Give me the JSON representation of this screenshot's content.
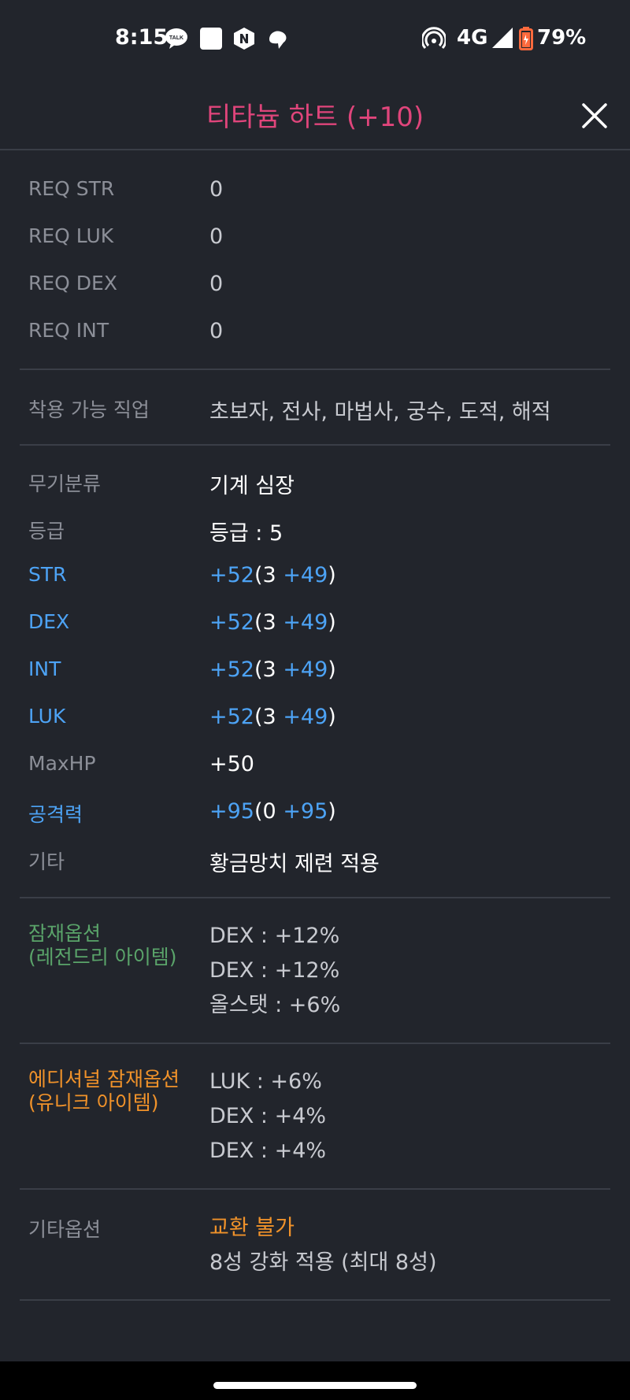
{
  "status_bar": {
    "time": "8:15",
    "network": "4G",
    "battery": "79%",
    "icons": [
      "talk-icon",
      "square-app-icon",
      "naver-icon",
      "cloud-app-icon",
      "hotspot-icon",
      "signal-icon",
      "battery-icon"
    ],
    "talk_icon_text": "TALK"
  },
  "header": {
    "title": "티타늄 하트 (+10)",
    "title_color": "#e0457b"
  },
  "requirements": [
    {
      "label": "REQ STR",
      "value": "0"
    },
    {
      "label": "REQ LUK",
      "value": "0"
    },
    {
      "label": "REQ DEX",
      "value": "0"
    },
    {
      "label": "REQ INT",
      "value": "0"
    }
  ],
  "jobs": {
    "label": "착용 가능 직업",
    "value": "초보자, 전사, 마법사, 궁수, 도적, 해적"
  },
  "info": {
    "category": {
      "label": "무기분류",
      "value": "기계 심장"
    },
    "grade": {
      "label": "등급",
      "value": "등급 : 5"
    },
    "stats": [
      {
        "label": "STR",
        "total": "+52",
        "base": "3",
        "bonus": "+49"
      },
      {
        "label": "DEX",
        "total": "+52",
        "base": "3",
        "bonus": "+49"
      },
      {
        "label": "INT",
        "total": "+52",
        "base": "3",
        "bonus": "+49"
      },
      {
        "label": "LUK",
        "total": "+52",
        "base": "3",
        "bonus": "+49"
      }
    ],
    "maxhp": {
      "label": "MaxHP",
      "value": "+50"
    },
    "attack": {
      "label": "공격력",
      "total": "+95",
      "base": "0",
      "bonus": "+95"
    },
    "etc": {
      "label": "기타",
      "value": "황금망치 제련 적용"
    }
  },
  "potential": {
    "label_line1": "잠재옵션",
    "label_line2": "(레전드리 아이템)",
    "lines": [
      "DEX : +12%",
      "DEX : +12%",
      "올스탯 : +6%"
    ],
    "color": "#5aa46a"
  },
  "additional": {
    "label_line1": "에디셔널 잠재옵션",
    "label_line2": "(유니크 아이템)",
    "lines": [
      "LUK : +6%",
      "DEX : +4%",
      "DEX : +4%"
    ],
    "color": "#f0922a"
  },
  "other_options": {
    "label": "기타옵션",
    "trade": "교환 불가",
    "star": "8성 강화 적용 (최대 8성)"
  },
  "colors": {
    "background": "#22252c",
    "stat_blue": "#4da3f5",
    "divider": "#3a3e47"
  }
}
